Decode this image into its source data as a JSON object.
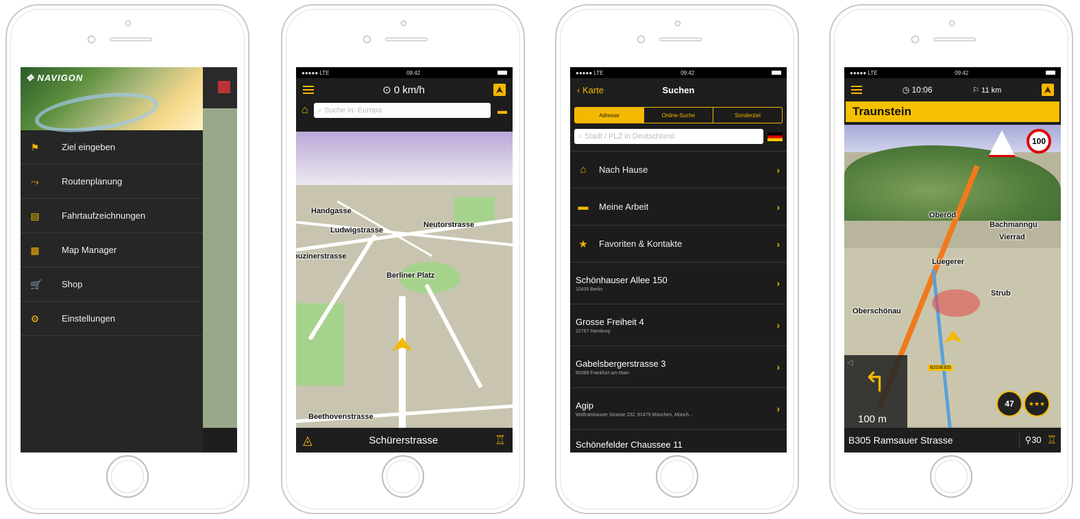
{
  "phone1": {
    "brand": "NAVIGON",
    "menu": [
      {
        "icon": "flag-icon",
        "label": "Ziel eingeben"
      },
      {
        "icon": "route-icon",
        "label": "Routenplanung"
      },
      {
        "icon": "logbook-icon",
        "label": "Fahrtaufzeichnungen"
      },
      {
        "icon": "map-manager-icon",
        "label": "Map Manager"
      },
      {
        "icon": "cart-icon",
        "label": "Shop"
      },
      {
        "icon": "settings-icon",
        "label": "Einstellungen"
      }
    ]
  },
  "phone2": {
    "status": {
      "carrier": "●●●●● LTE",
      "time": "09:42"
    },
    "speed": "0 km/h",
    "search_placeholder": "Suche in: Europa",
    "map_labels": [
      "Handgasse",
      "Ludwigstrasse",
      "Neutorstrasse",
      "puzinerstrasse",
      "Berliner Platz",
      "Beethovenstrasse"
    ],
    "current_street": "Schürerstrasse"
  },
  "phone3": {
    "status": {
      "carrier": "●●●●● LTE",
      "time": "09:42"
    },
    "back_label": "Karte",
    "title": "Suchen",
    "tabs": [
      "Adresse",
      "Online-Suche",
      "Sonderziel"
    ],
    "search_placeholder": "Stadt / PLZ in Deutschland",
    "quick": [
      {
        "icon": "home-icon",
        "label": "Nach Hause"
      },
      {
        "icon": "briefcase-icon",
        "label": "Meine Arbeit"
      },
      {
        "icon": "star-icon",
        "label": "Favoriten & Kontakte"
      }
    ],
    "recent": [
      {
        "title": "Schönhauser Allee 150",
        "sub": "10435 Berlin"
      },
      {
        "title": "Grosse Freiheit 4",
        "sub": "22767 Hamburg"
      },
      {
        "title": "Gabelsbergerstrasse 3",
        "sub": "60389 Frankfurt am Main"
      },
      {
        "title": "Agip",
        "sub": "Wolfratshauser Strasse 232, 81479 München, Münch..."
      },
      {
        "title": "Schönefelder Chaussee 11",
        "sub": ""
      }
    ]
  },
  "phone4": {
    "status": {
      "carrier": "●●●●● LTE",
      "time": "09:42"
    },
    "eta": "10:06",
    "distance": "11 km",
    "destination": "Traunstein",
    "speed_limit": "100",
    "map_labels": [
      "Oberöd",
      "Bachmanngu",
      "Vierrad",
      "Luegerer",
      "Strub",
      "Oberschönau",
      "B20/B305"
    ],
    "turn_distance": "100 m",
    "current_speed": "47",
    "street": "B305 Ramsauer Strasse",
    "count": "30"
  },
  "colors": {
    "accent": "#f5b800",
    "bar": "#1e1e1e"
  }
}
